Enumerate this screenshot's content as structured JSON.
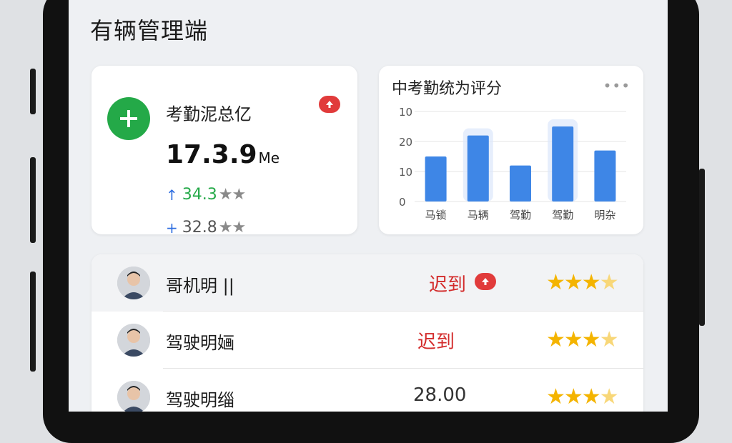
{
  "app_title": "有辆管理端",
  "summary_card": {
    "title": "考勤泥总亿",
    "value": "17.3.9",
    "unit": "Me",
    "stat1": {
      "value": "34.3",
      "stars": "★★"
    },
    "stat2": {
      "value": "32.8",
      "stars": "★★"
    }
  },
  "chart_card": {
    "title": "中考勤统为评分",
    "more": "•••"
  },
  "chart_data": {
    "type": "bar",
    "categories": [
      "马锁",
      "马辆",
      "驾勤",
      "驾勤",
      "明杂"
    ],
    "values": [
      15,
      22,
      12,
      25,
      17
    ],
    "yticks": [
      "10",
      "20",
      "10",
      "0"
    ],
    "ylim": [
      0,
      30
    ],
    "bar_color": "#3e86e6",
    "highlight": [
      1,
      3
    ]
  },
  "drivers": [
    {
      "name": "哥机明 ||",
      "status": "迟到",
      "status_badge": true,
      "rating": "★★★",
      "half": "★"
    },
    {
      "name": "驾驶明婳",
      "status": "迟到",
      "status_badge": false,
      "rating": "★★★",
      "half": "★"
    },
    {
      "name": "驾驶明缁",
      "status": "28.00",
      "status_badge": false,
      "rating": "★★★",
      "half": "★"
    }
  ],
  "colors": {
    "accent_green": "#24a948",
    "alert_red": "#e13b3b",
    "star": "#f4b400"
  }
}
